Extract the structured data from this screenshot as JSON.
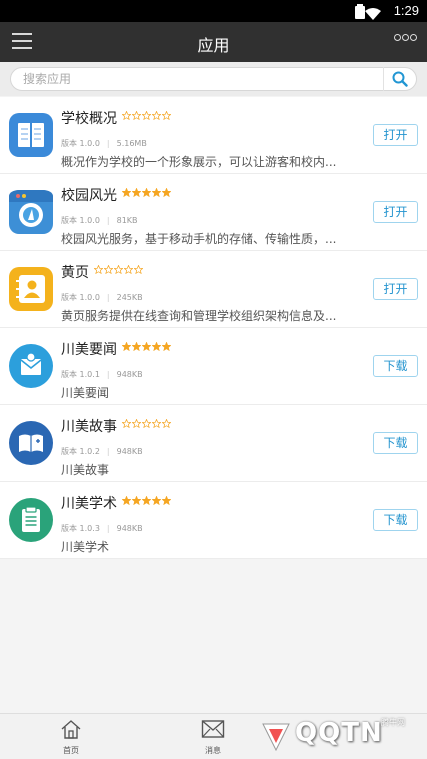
{
  "status_bar": {
    "time": "1:29"
  },
  "header": {
    "title": "应用"
  },
  "search": {
    "placeholder": "搜索应用"
  },
  "labels": {
    "version_prefix": "版本"
  },
  "apps": [
    {
      "name": "学校概况",
      "rating": 0,
      "version": "1.0.0",
      "size": "5.16MB",
      "description": "概况作为学校的一个形象展示，可以让游客和校内...",
      "action": "打开",
      "icon": "book-icon",
      "icon_color": "#3b8ad9"
    },
    {
      "name": "校园风光",
      "rating": 5,
      "version": "1.0.0",
      "size": "81KB",
      "description": "校园风光服务，基于移动手机的存储、传输性质，...",
      "action": "打开",
      "icon": "camera-icon",
      "icon_color": "#3d8fd6"
    },
    {
      "name": "黄页",
      "rating": 0,
      "version": "1.0.0",
      "size": "245KB",
      "description": "黄页服务提供在线查询和管理学校组织架构信息及...",
      "action": "打开",
      "icon": "contact-book-icon",
      "icon_color": "#f4b21c"
    },
    {
      "name": "川美要闻",
      "rating": 5,
      "version": "1.0.1",
      "size": "948KB",
      "description": "川美要闻",
      "action": "下载",
      "icon": "mail-icon",
      "icon_color": "#2c9fdc"
    },
    {
      "name": "川美故事",
      "rating": 0,
      "version": "1.0.2",
      "size": "948KB",
      "description": "川美故事",
      "action": "下载",
      "icon": "open-book-icon",
      "icon_color": "#2a67b3"
    },
    {
      "name": "川美学术",
      "rating": 5,
      "version": "1.0.3",
      "size": "948KB",
      "description": "川美学术",
      "action": "下载",
      "icon": "clipboard-icon",
      "icon_color": "#2aa37a"
    }
  ],
  "bottom_nav": [
    {
      "label": "首页",
      "icon": "home-icon"
    },
    {
      "label": "消息",
      "icon": "envelope-icon"
    }
  ],
  "watermark": {
    "text": "QQTN",
    "subtext": "腾牛网"
  },
  "colors": {
    "star": "#f5a623",
    "button_text": "#2494cf",
    "app_bar": "#303030"
  }
}
